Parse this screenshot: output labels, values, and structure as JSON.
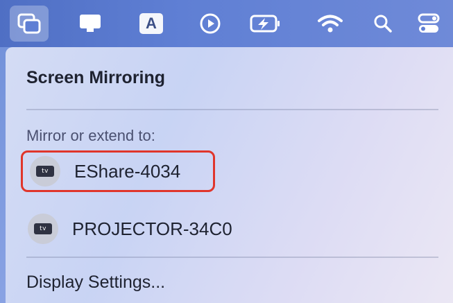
{
  "menubar": {
    "items": [
      {
        "icon": "screen-mirroring-icon",
        "active": true
      },
      {
        "icon": "display-icon"
      },
      {
        "icon": "input-source-icon",
        "label": "A"
      },
      {
        "icon": "now-playing-icon"
      },
      {
        "icon": "battery-charging-icon"
      },
      {
        "icon": "wifi-icon"
      },
      {
        "icon": "spotlight-search-icon"
      },
      {
        "icon": "control-center-icon"
      }
    ]
  },
  "panel": {
    "title": "Screen Mirroring",
    "section_label": "Mirror or extend to:",
    "devices": [
      {
        "name": "EShare-4034",
        "badge": "tv",
        "highlighted": true
      },
      {
        "name": "PROJECTOR-34C0",
        "badge": "tv",
        "highlighted": false
      }
    ],
    "settings_label": "Display Settings..."
  },
  "colors": {
    "highlight_border": "#e0352b",
    "menubar": "#5f7fd4"
  }
}
